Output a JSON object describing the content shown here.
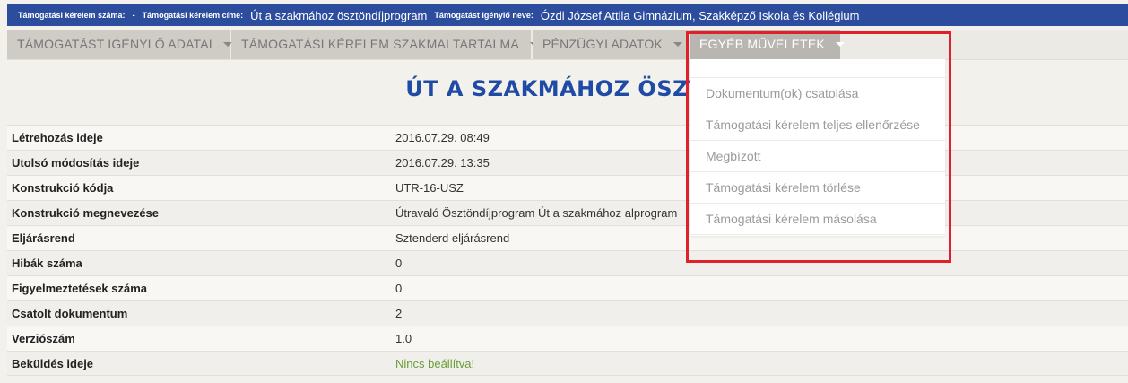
{
  "header": {
    "request_number_label": "Támogatási kérelem száma:",
    "request_number_value": "",
    "separator": "-",
    "request_title_label": "Támogatási kérelem címe:",
    "request_title_value": "Út a szakmához ösztöndíjprogram",
    "applicant_label": "Támogatást igénylő neve:",
    "applicant_value": "Ózdi József Attila Gimnázium, Szakképző Iskola és Kollégium"
  },
  "menu": [
    {
      "label": "Támogatást igénylő adatai"
    },
    {
      "label": "Támogatási kérelem szakmai tartalma"
    },
    {
      "label": "Pénzügyi adatok"
    },
    {
      "label": "Egyéb műveletek"
    }
  ],
  "page_title": "ÚT A SZAKMÁHOZ ÖSZTÖ",
  "dropdown": {
    "items": [
      "Dokumentum(ok) csatolása",
      "Támogatási kérelem teljes ellenőrzése",
      "Megbízott",
      "Támogatási kérelem törlése",
      "Támogatási kérelem másolása"
    ]
  },
  "details": [
    {
      "label": "Létrehozás ideje",
      "value": "2016.07.29. 08:49"
    },
    {
      "label": "Utolsó módosítás ideje",
      "value": "2016.07.29. 13:35"
    },
    {
      "label": "Konstrukció kódja",
      "value": "UTR-16-USZ"
    },
    {
      "label": "Konstrukció megnevezése",
      "value": "Útravaló Ösztöndíjprogram Út a szakmához alprogram"
    },
    {
      "label": "Eljárásrend",
      "value": "Sztenderd eljárásrend"
    },
    {
      "label": "Hibák száma",
      "value": "0"
    },
    {
      "label": "Figyelmeztetések száma",
      "value": "0"
    },
    {
      "label": "Csatolt dokumentum",
      "value": "2"
    },
    {
      "label": "Verziószám",
      "value": "1.0"
    },
    {
      "label": "Beküldés ideje",
      "value": "Nincs beállítva!"
    }
  ],
  "colors": {
    "header_bg": "#2c4d9e",
    "title": "#1f4aa5",
    "not_set": "#6a9c3a",
    "highlight": "#e0202a"
  }
}
